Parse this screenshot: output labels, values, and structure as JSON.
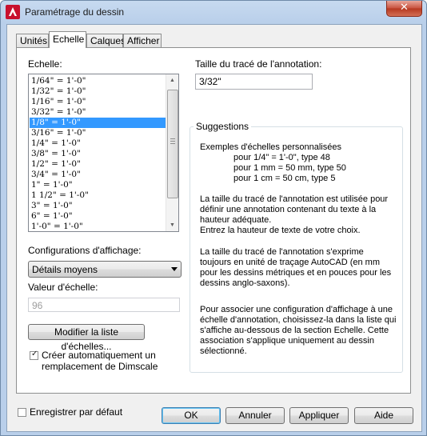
{
  "window": {
    "title": "Paramétrage du dessin",
    "close_glyph": "✕",
    "app_icon": "autocad-a-logo-icon"
  },
  "tabs": [
    {
      "label": "Unités"
    },
    {
      "label": "Echelle"
    },
    {
      "label": "Calques"
    },
    {
      "label": "Afficher"
    }
  ],
  "scale_panel": {
    "label": "Echelle:",
    "items": [
      "1/64\" = 1'-0\"",
      "1/32\" = 1'-0\"",
      "1/16\" = 1'-0\"",
      "3/32\" = 1'-0\"",
      "1/8\" = 1'-0\"",
      "3/16\" = 1'-0\"",
      "1/4\" = 1'-0\"",
      "3/8\" = 1'-0\"",
      "1/2\" = 1'-0\"",
      "3/4\" = 1'-0\"",
      "1\" = 1'-0\"",
      "1 1/2\" = 1'-0\"",
      "3\" = 1'-0\"",
      "6\" = 1'-0\"",
      "1'-0\" = 1'-0\""
    ],
    "selected_index": 4,
    "display_config_label": "Configurations d'affichage:",
    "display_config_value": "Détails moyens",
    "scale_value_label": "Valeur d'échelle:",
    "scale_value": "96",
    "modify_button": "Modifier la liste d'échelles...",
    "dimscale_line1": "Créer automatiquement un",
    "dimscale_line2": "remplacement de Dimscale",
    "dimscale_checked": true
  },
  "annotation": {
    "label": "Taille du tracé de l'annotation:",
    "value": "3/32\""
  },
  "suggestions": {
    "title": "Suggestions",
    "examples_heading": "Exemples d'échelles personnalisées",
    "examples": [
      "pour 1/4\" = 1'-0\", type 48",
      "pour 1 mm = 50 mm, type 50",
      "pour 1 cm = 50 cm, type 5"
    ],
    "para1": [
      "La taille du tracé de l'annotation est utilisée pour",
      "définir une annotation contenant du texte à la",
      "hauteur adéquate.",
      "Entrez la hauteur de texte de votre choix."
    ],
    "para2": [
      "La taille du tracé de l'annotation s'exprime",
      "toujours en unité de traçage AutoCAD (en mm",
      "pour les dessins métriques et en pouces pour les",
      "dessins anglo-saxons)."
    ],
    "para3": [
      "Pour associer une configuration d'affichage à une",
      "échelle d'annotation, choisissez-la dans la liste qui",
      "s'affiche au-dessous de la section Echelle. Cette",
      "association s'applique uniquement au dessin",
      "sélectionné."
    ]
  },
  "footer": {
    "save_default_label": "Enregistrer par défaut",
    "save_default_checked": false,
    "ok": "OK",
    "cancel": "Annuler",
    "apply": "Appliquer",
    "help": "Aide"
  }
}
